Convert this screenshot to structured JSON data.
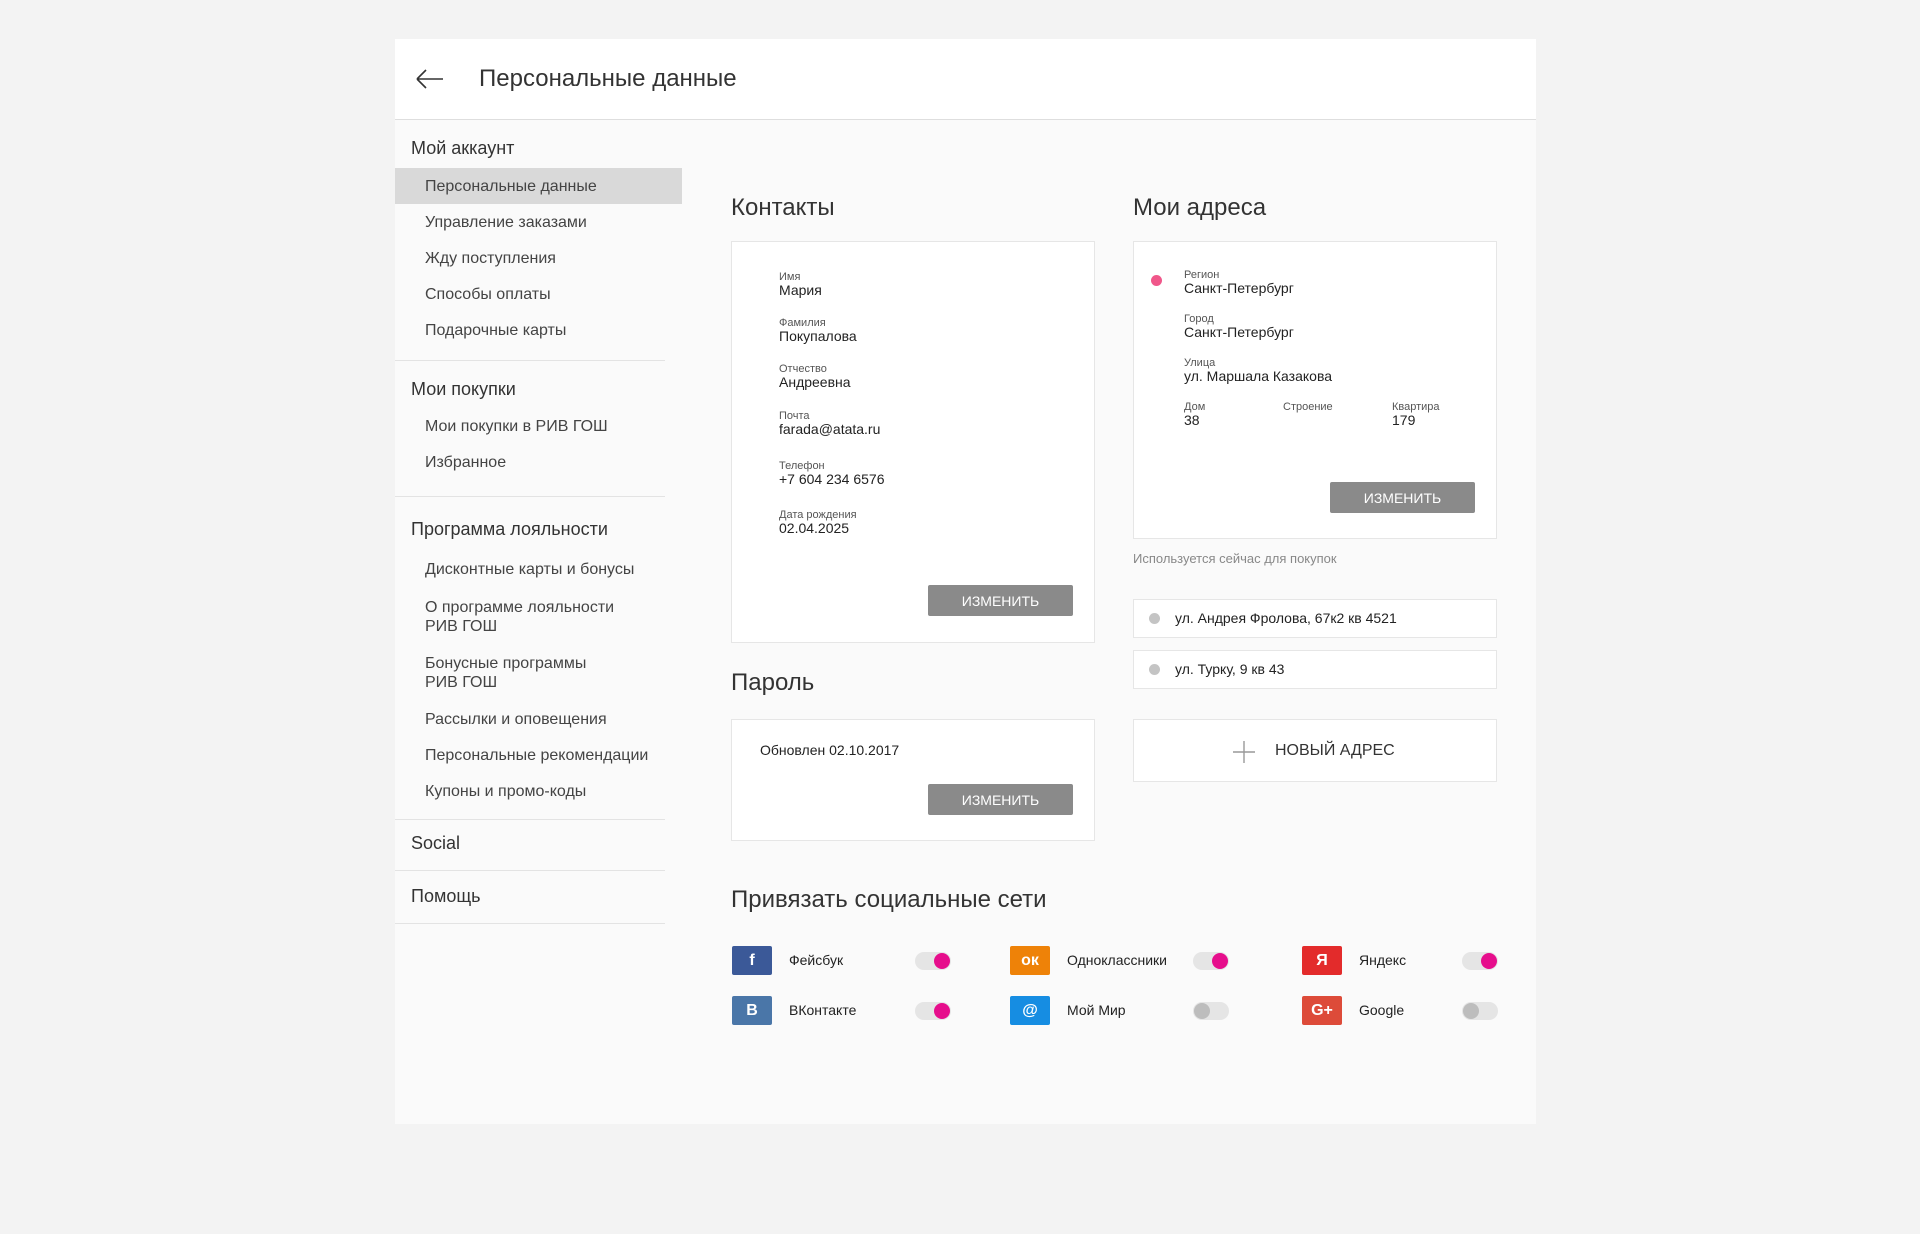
{
  "header": {
    "title": "Персональные данные"
  },
  "sidebar": {
    "sections": [
      {
        "title": "Мой аккаунт",
        "items": [
          "Персональные данные",
          "Управление заказами",
          "Жду поступления",
          "Способы оплаты",
          "Подарочные карты"
        ]
      },
      {
        "title": "Мои покупки",
        "items": [
          "Мои покупки в РИВ ГОШ",
          "Избранное"
        ]
      },
      {
        "title": "Программа лояльности",
        "items": [
          "Дисконтные карты и бонусы",
          "О программе лояльности",
          "РИВ ГОШ",
          "Бонусные программы",
          "РИВ ГОШ",
          "Рассылки и оповещения",
          "Персональные рекомендации",
          "Купоны и промо-коды"
        ]
      },
      {
        "title": "Social"
      },
      {
        "title": "Помощь"
      }
    ],
    "active_item": "Персональные данные"
  },
  "contacts": {
    "title": "Контакты",
    "fields": [
      {
        "label": "Имя",
        "value": "Мария"
      },
      {
        "label": "Фамилия",
        "value": "Покупалова"
      },
      {
        "label": "Отчество",
        "value": "Андреевна"
      },
      {
        "label": "Почта",
        "value": "farada@atata.ru"
      },
      {
        "label": "Телефон",
        "value": "+7 604 234 6576"
      },
      {
        "label": "Дата рождения",
        "value": "02.04.2025"
      }
    ],
    "button": "ИЗМЕНИТЬ"
  },
  "password": {
    "title": "Пароль",
    "updated": "Обновлен 02.10.2017",
    "button": "ИЗМЕНИТЬ"
  },
  "addresses": {
    "title": "Мои адреса",
    "primary": {
      "region_label": "Регион",
      "region": "Санкт-Петербург",
      "city_label": "Город",
      "city": "Санкт-Петербург",
      "street_label": "Улица",
      "street": "ул. Маршала Казакова",
      "house_label": "Дом",
      "house": "38",
      "building_label": "Строение",
      "building": "",
      "apartment_label": "Квартира",
      "apartment": "179",
      "button": "ИЗМЕНИТЬ"
    },
    "note": "Используется сейчас для покупок",
    "others": [
      "ул. Андрея Фролова, 67к2 кв 4521",
      "ул. Турку, 9 кв 43"
    ],
    "new_address": "НОВЫЙ АДРЕС",
    "active_color": "#f0578a",
    "inactive_color": "#c4c4c4"
  },
  "social": {
    "title": "Привязать социальные сети",
    "networks": [
      {
        "name": "Фейсбук",
        "icon": "facebook-icon",
        "glyph": "f",
        "color": "#3b5998",
        "enabled": true
      },
      {
        "name": "Одноклассники",
        "icon": "odnoklassniki-icon",
        "glyph": "ок",
        "color": "#ee8208",
        "enabled": true
      },
      {
        "name": "Яндекс",
        "icon": "yandex-icon",
        "glyph": "Я",
        "color": "#e32b2b",
        "enabled": true
      },
      {
        "name": "ВКонтакте",
        "icon": "vk-icon",
        "glyph": "В",
        "color": "#4a76a8",
        "enabled": true
      },
      {
        "name": "Мой Мир",
        "icon": "mail-mir-icon",
        "glyph": "@",
        "color": "#168de2",
        "enabled": false
      },
      {
        "name": "Google",
        "icon": "google-plus-icon",
        "glyph": "G+",
        "color": "#dd4b39",
        "enabled": false
      }
    ],
    "toggle_on_color": "#e60e8c"
  }
}
